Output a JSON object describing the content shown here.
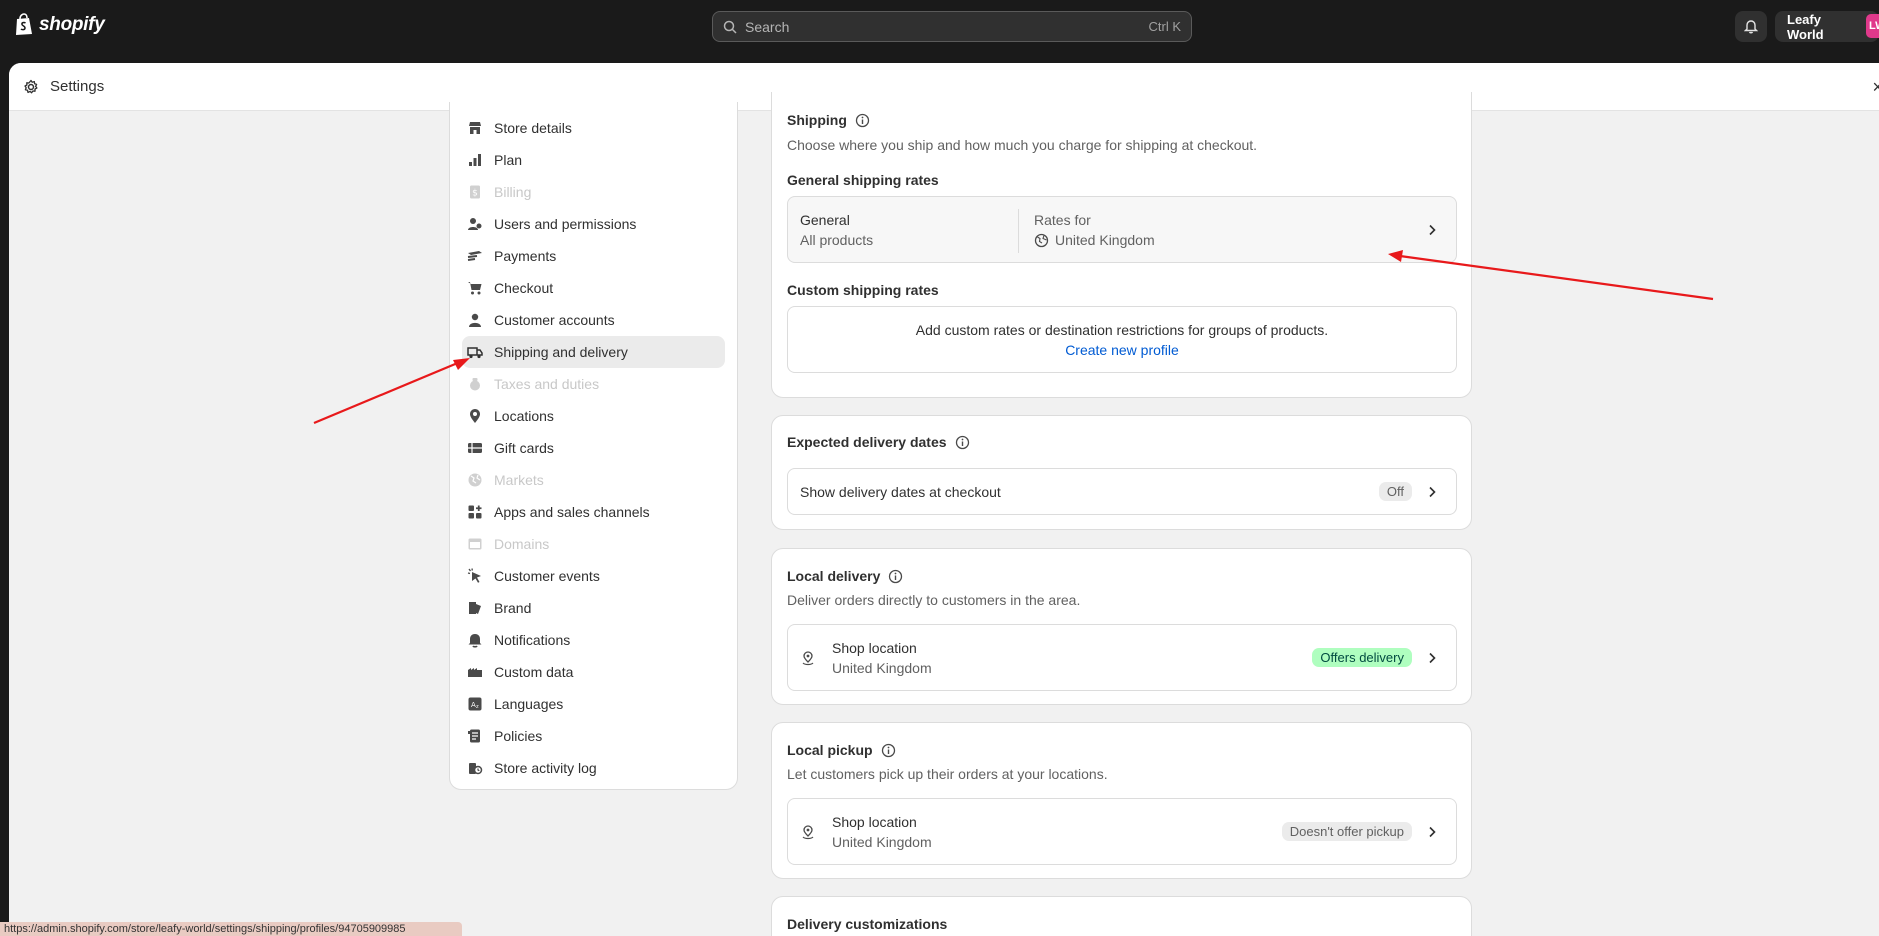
{
  "topbar": {
    "brand": "shopify",
    "search_placeholder": "Search",
    "search_shortcut": "Ctrl K",
    "store_name": "Leafy World",
    "avatar_initials": "LW"
  },
  "modal": {
    "title": "Settings",
    "close_glyph": "×"
  },
  "sidebar": {
    "items": [
      {
        "label": "Store details",
        "icon": "store-icon",
        "state": "normal"
      },
      {
        "label": "Plan",
        "icon": "plan-icon",
        "state": "normal"
      },
      {
        "label": "Billing",
        "icon": "billing-icon",
        "state": "disabled"
      },
      {
        "label": "Users and permissions",
        "icon": "users-icon",
        "state": "normal"
      },
      {
        "label": "Payments",
        "icon": "payments-icon",
        "state": "normal"
      },
      {
        "label": "Checkout",
        "icon": "cart-icon",
        "state": "normal"
      },
      {
        "label": "Customer accounts",
        "icon": "person-icon",
        "state": "normal"
      },
      {
        "label": "Shipping and delivery",
        "icon": "truck-icon",
        "state": "active"
      },
      {
        "label": "Taxes and duties",
        "icon": "tax-icon",
        "state": "disabled"
      },
      {
        "label": "Locations",
        "icon": "location-pin-icon",
        "state": "normal"
      },
      {
        "label": "Gift cards",
        "icon": "gift-card-icon",
        "state": "normal"
      },
      {
        "label": "Markets",
        "icon": "globe-icon",
        "state": "disabled"
      },
      {
        "label": "Apps and sales channels",
        "icon": "apps-icon",
        "state": "normal"
      },
      {
        "label": "Domains",
        "icon": "domains-icon",
        "state": "disabled"
      },
      {
        "label": "Customer events",
        "icon": "cursor-icon",
        "state": "normal"
      },
      {
        "label": "Brand",
        "icon": "brand-icon",
        "state": "normal"
      },
      {
        "label": "Notifications",
        "icon": "bell-icon",
        "state": "normal"
      },
      {
        "label": "Custom data",
        "icon": "custom-data-icon",
        "state": "normal"
      },
      {
        "label": "Languages",
        "icon": "languages-icon",
        "state": "normal"
      },
      {
        "label": "Policies",
        "icon": "policies-icon",
        "state": "normal"
      },
      {
        "label": "Store activity log",
        "icon": "activity-log-icon",
        "state": "normal"
      }
    ]
  },
  "shipping": {
    "title": "Shipping",
    "description": "Choose where you ship and how much you charge for shipping at checkout.",
    "general_heading": "General shipping rates",
    "general_profile": {
      "name": "General",
      "scope": "All products",
      "rates_label": "Rates for",
      "rates_region": "United Kingdom"
    },
    "custom_heading": "Custom shipping rates",
    "custom_text": "Add custom rates or destination restrictions for groups of products.",
    "custom_link": "Create new profile"
  },
  "expected_delivery": {
    "title": "Expected delivery dates",
    "row_label": "Show delivery dates at checkout",
    "badge": "Off"
  },
  "local_delivery": {
    "title": "Local delivery",
    "description": "Deliver orders directly to customers in the area.",
    "location_name": "Shop location",
    "location_country": "United Kingdom",
    "badge": "Offers delivery"
  },
  "local_pickup": {
    "title": "Local pickup",
    "description": "Let customers pick up their orders at your locations.",
    "location_name": "Shop location",
    "location_country": "United Kingdom",
    "badge": "Doesn't offer pickup"
  },
  "delivery_customizations": {
    "title": "Delivery customizations"
  },
  "status_bar": {
    "url": "https://admin.shopify.com/store/leafy-world/settings/shipping/profiles/94705909985"
  },
  "colors": {
    "annotation_arrow": "#e8191b",
    "link": "#005bd3",
    "success_badge_bg": "#affebf",
    "success_badge_text": "#014b40"
  }
}
